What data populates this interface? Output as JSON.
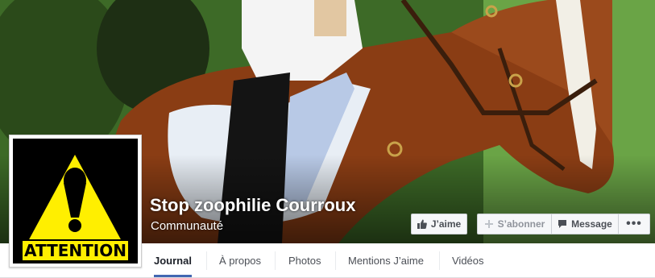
{
  "page": {
    "title": "Stop zoophilie Courroux",
    "category": "Communauté"
  },
  "actions": {
    "like_label": "J’aime",
    "subscribe_label": "S’abonner",
    "message_label": "Message",
    "more_label": "•••"
  },
  "profile": {
    "badge_text": "ATTENTION"
  },
  "nav": {
    "tabs": [
      {
        "label": "Journal",
        "active": true
      },
      {
        "label": "À propos",
        "active": false
      },
      {
        "label": "Photos",
        "active": false
      },
      {
        "label": "Mentions J’aime",
        "active": false
      },
      {
        "label": "Vidéos",
        "active": false
      }
    ]
  },
  "icons": {
    "like": "thumbs-up-icon",
    "subscribe": "plus-icon",
    "message": "chat-bubble-icon"
  },
  "colors": {
    "accent": "#4267b2",
    "warning_yellow": "#ffef00"
  }
}
